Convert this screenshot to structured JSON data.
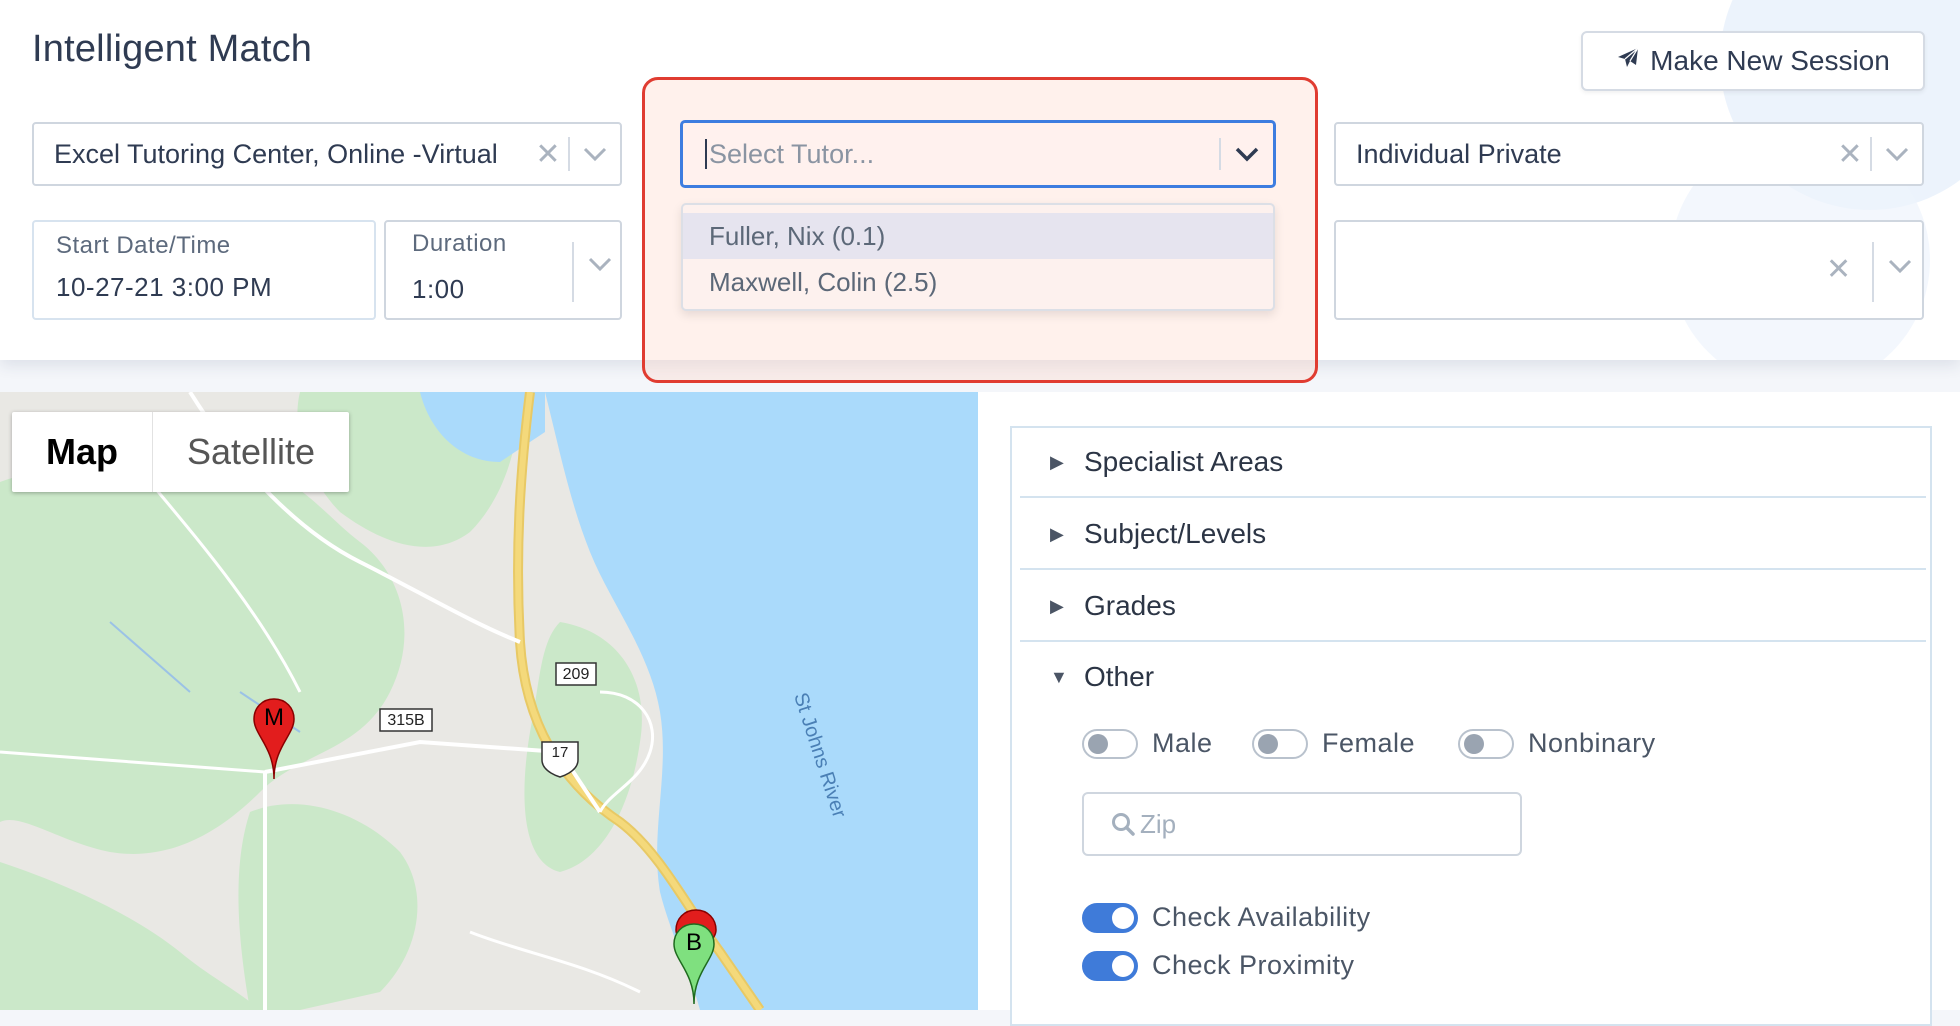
{
  "header": {
    "title": "Intelligent Match",
    "new_session_label": "Make New Session"
  },
  "filters": {
    "location": {
      "value": "Excel Tutoring Center, Online -Virtual"
    },
    "tutor": {
      "placeholder": "Select Tutor...",
      "options": [
        "Fuller, Nix (0.1)",
        "Maxwell, Colin (2.5)"
      ]
    },
    "session_type": {
      "value": "Individual Private"
    },
    "start": {
      "label": "Start Date/Time",
      "value": "10-27-21 3:00 PM"
    },
    "duration": {
      "label": "Duration",
      "value": "1:00"
    }
  },
  "map": {
    "type_options": [
      "Map",
      "Satellite"
    ],
    "selected_type": "Map",
    "river_label": "St Johns River",
    "road_labels": [
      "209",
      "315B",
      "17"
    ],
    "markers": [
      "M",
      "B"
    ]
  },
  "accordion": {
    "sections": [
      "Specialist Areas",
      "Subject/Levels",
      "Grades",
      "Other"
    ],
    "other": {
      "gender_toggles": [
        {
          "label": "Male",
          "on": false
        },
        {
          "label": "Female",
          "on": false
        },
        {
          "label": "Nonbinary",
          "on": false
        }
      ],
      "zip_placeholder": "Zip",
      "check_availability": {
        "label": "Check Availability",
        "on": true
      },
      "check_proximity": {
        "label": "Check Proximity",
        "on": true
      }
    }
  },
  "colors": {
    "accent_blue": "#3d7de0",
    "highlight_red": "#e03c31",
    "water": "#aadafb",
    "park_green": "#cbe8c9",
    "highway_yellow": "#f4d97b"
  }
}
